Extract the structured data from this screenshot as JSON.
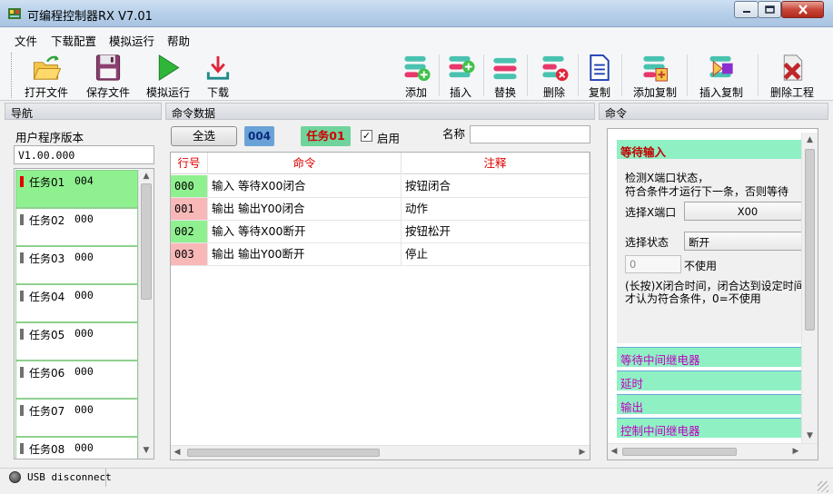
{
  "window": {
    "title": "可编程控制器RX V7.01"
  },
  "menu": [
    "文件",
    "下载配置",
    "模拟运行",
    "帮助"
  ],
  "toolbar": {
    "open": "打开文件",
    "save": "保存文件",
    "simulate": "模拟运行",
    "download": "下载",
    "add": "添加",
    "insert": "插入",
    "replace": "替换",
    "delete": "删除",
    "copy": "复制",
    "add_copy": "添加复制",
    "insert_copy": "插入复制",
    "delete_project": "删除工程"
  },
  "panels": {
    "nav": "导航",
    "data": "命令数据",
    "commands": "命令"
  },
  "nav": {
    "version_label": "用户程序版本",
    "version_value": "V1.00.000",
    "tasks": [
      {
        "name": "任务01",
        "count": "004"
      },
      {
        "name": "任务02",
        "count": "000"
      },
      {
        "name": "任务03",
        "count": "000"
      },
      {
        "name": "任务04",
        "count": "000"
      },
      {
        "name": "任务05",
        "count": "000"
      },
      {
        "name": "任务06",
        "count": "000"
      },
      {
        "name": "任务07",
        "count": "000"
      },
      {
        "name": "任务08",
        "count": "000"
      }
    ]
  },
  "data": {
    "select_all": "全选",
    "count": "004",
    "task": "任务01",
    "enable_label": "启用",
    "enable_checked": "✓",
    "name_label": "名称",
    "name_value": "",
    "columns": {
      "line": "行号",
      "command": "命令",
      "comment": "注释"
    },
    "rows": [
      {
        "line": "000",
        "command": "输入 等待X00闭合",
        "comment": "按钮闭合",
        "color": "#8ff08f"
      },
      {
        "line": "001",
        "command": "输出 输出Y00闭合",
        "comment": "动作",
        "color": "#f8b8b8"
      },
      {
        "line": "002",
        "command": "输入 等待X00断开",
        "comment": "按钮松开",
        "color": "#8ff08f"
      },
      {
        "line": "003",
        "command": "输出 输出Y00断开",
        "comment": "停止",
        "color": "#f8b8b8"
      }
    ]
  },
  "commands": {
    "active": "等待输入",
    "desc1": "检测X端口状态，",
    "desc2": "符合条件才运行下一条，否则等待",
    "port_label": "选择X端口",
    "port_value": "X00",
    "state_label": "选择状态",
    "state_value": "断开",
    "time_value": "0",
    "time_unit": "不使用",
    "note1": "(长按)X闭合时间，闭合达到设定时间",
    "note2": "才认为符合条件，0=不使用",
    "categories": [
      "等待中间继电器",
      "延时",
      "输出",
      "控制中间继电器"
    ]
  },
  "status": {
    "usb": "USB disconnect"
  }
}
